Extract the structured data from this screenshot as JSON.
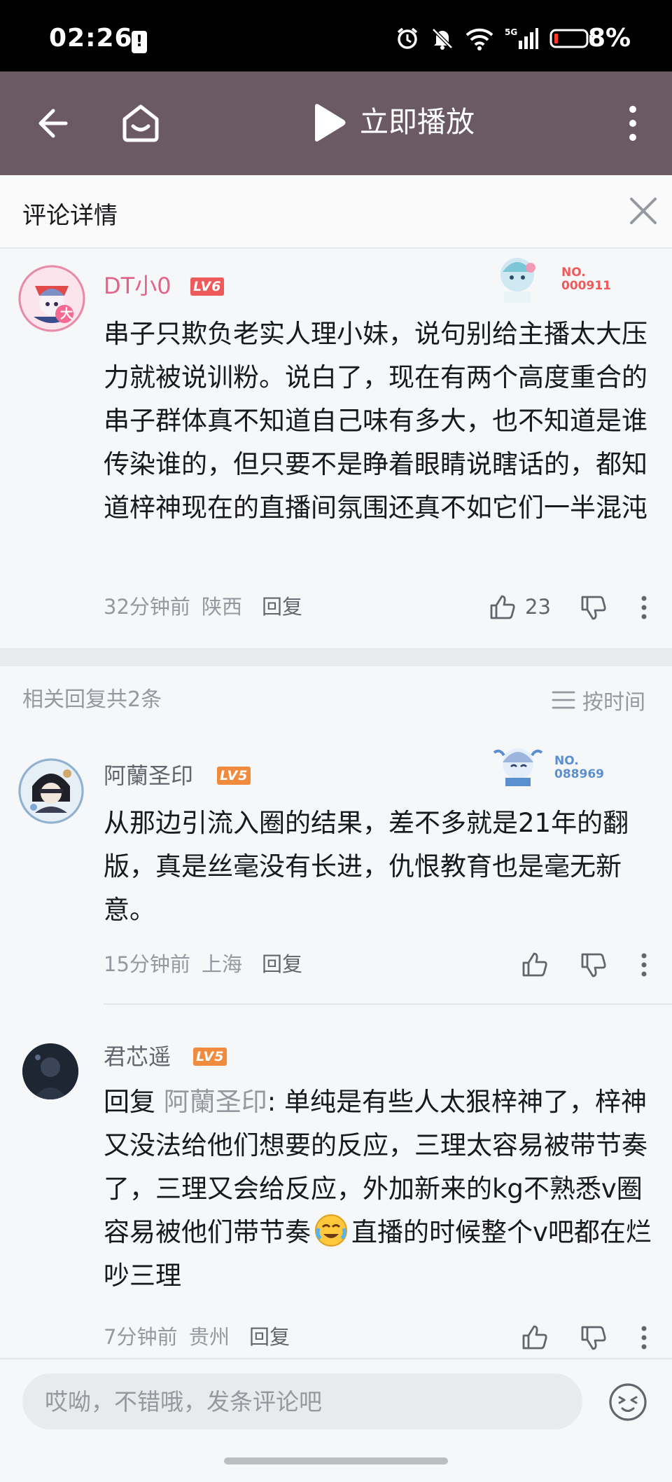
{
  "status_bar": {
    "time": "02:26",
    "battery": "8%",
    "warn_icon": "!"
  },
  "top_bar": {
    "title": "立即播放",
    "icons": [
      "back-arrow-icon",
      "home-icon",
      "play-icon",
      "more-vert-icon"
    ]
  },
  "detail": {
    "title": "评论详情"
  },
  "main_comment": {
    "username": "DT小0",
    "level": "LV6",
    "badge_no_label": "NO.",
    "badge_no": "000911",
    "text": "串子只欺负老实人理小妹，说句别给主播太大压力就被说训粉。说白了，现在有两个高度重合的串子群体真不知道自己味有多大，也不知道是谁传染谁的，但只要不是睁着眼睛说瞎话的，都知道梓神现在的直播间氛围还真不如它们一半混沌",
    "time": "32分钟前",
    "location": "陕西",
    "reply_label": "回复",
    "likes": "23",
    "avatar_badge": "大"
  },
  "replies_section": {
    "count_label": "相关回复共2条",
    "sort_label": "按时间"
  },
  "replies": [
    {
      "username": "阿蘭圣印",
      "level": "LV5",
      "badge_no_label": "NO.",
      "badge_no": "088969",
      "text": "从那边引流入圈的结果，差不多就是21年的翻版，真是丝毫没有长进，仇恨教育也是毫无新意。",
      "time": "15分钟前",
      "location": "上海",
      "reply_label": "回复"
    },
    {
      "username": "君芯遥",
      "level": "LV5",
      "reply_prefix": "回复 ",
      "mention": "阿蘭圣印",
      "text_before_emoji": ": 单纯是有些人太狠梓神了，梓神又没法给他们想要的反应，三理太容易被带节奏了，三理又会给反应，外加新来的kg不熟悉v圈容易被他们带节奏",
      "text_after_emoji": "直播的时候整个v吧都在烂吵三理",
      "time": "7分钟前",
      "location": "贵州",
      "reply_label": "回复"
    }
  ],
  "bottom_bar": {
    "placeholder": "哎呦，不错哦，发条评论吧"
  },
  "colors": {
    "top_bar": "#6b5a63",
    "level6": "#ee5a5a",
    "level5": "#f08a3c",
    "username_pink": "#e1628a",
    "meta_gray": "#9499a0"
  }
}
